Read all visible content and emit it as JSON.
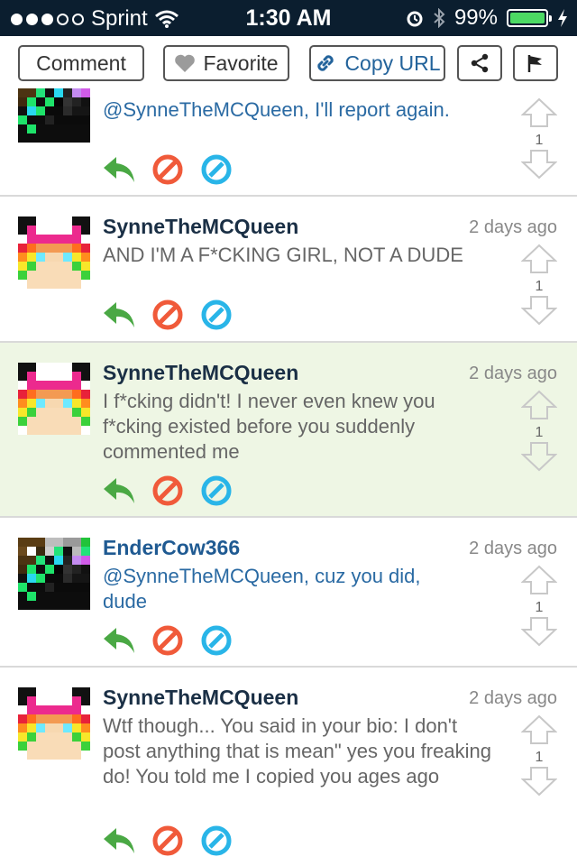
{
  "status_bar": {
    "carrier": "Sprint",
    "time": "1:30 AM",
    "battery_percent": "99%",
    "battery_level": 0.99,
    "signal_bars_filled": 3,
    "signal_bars_total": 5
  },
  "toolbar": {
    "comment_label": "Comment",
    "favorite_label": "Favorite",
    "copy_url_label": "Copy URL"
  },
  "comments": [
    {
      "username": "",
      "time_ago": "",
      "body": "@SynneTheMCQueen, I'll report again.",
      "votes": "1",
      "avatar": "endercow"
    },
    {
      "username": "SynneTheMCQueen",
      "time_ago": "2 days ago",
      "body": "AND I'M A F*CKING GIRL, NOT A DUDE",
      "votes": "1",
      "avatar": "synne"
    },
    {
      "username": "SynneTheMCQueen",
      "time_ago": "2 days ago",
      "body": "I f*cking didn't! I never even knew you f*cking existed before you suddenly commented me",
      "votes": "1",
      "avatar": "synne"
    },
    {
      "username": "EnderCow366",
      "time_ago": "2 days ago",
      "body": "@SynneTheMCQueen, cuz you did, dude",
      "votes": "1",
      "avatar": "endercow"
    },
    {
      "username": "SynneTheMCQueen",
      "time_ago": "2 days ago",
      "body": "Wtf though... You said in your bio: I don't post anything that is mean\" yes you freaking do! You told me I copied you ages ago",
      "votes": "1",
      "avatar": "synne"
    }
  ],
  "colors": {
    "status_bar_bg": "#0b1e2f",
    "highlight_bg": "#eef6e4",
    "reply_green": "#4aa844",
    "block_red": "#f05a3a",
    "mod_blue": "#29b5e8",
    "link_blue": "#2a6aa3"
  },
  "icons": [
    "signal-dots-icon",
    "wifi-icon",
    "alarm-icon",
    "bluetooth-icon",
    "battery-icon",
    "charging-icon",
    "heart-icon",
    "link-icon",
    "share-icon",
    "flag-icon",
    "reply-icon",
    "block-icon",
    "moderate-icon",
    "upvote-icon",
    "downvote-icon"
  ]
}
